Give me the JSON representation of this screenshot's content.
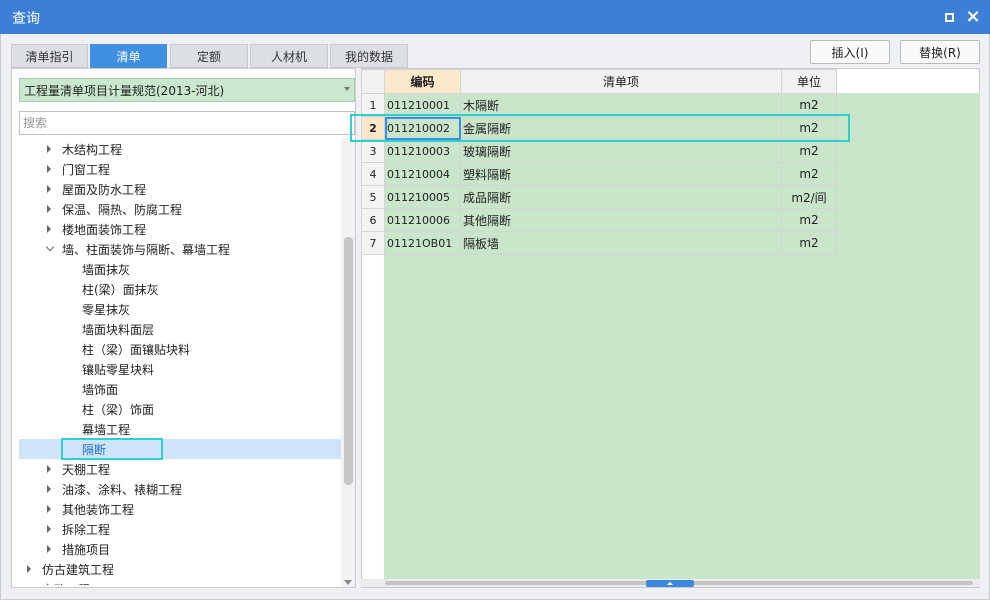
{
  "window": {
    "title": "查询"
  },
  "tabs": [
    {
      "label": "清单指引"
    },
    {
      "label": "清单"
    },
    {
      "label": "定额"
    },
    {
      "label": "人材机"
    },
    {
      "label": "我的数据"
    }
  ],
  "toolbar": {
    "insert_label": "插入(I)",
    "replace_label": "替换(R)"
  },
  "left": {
    "spec_select": "工程量清单项目计量规范(2013-河北)",
    "search_placeholder": "搜索",
    "tree": [
      {
        "label": "木结构工程",
        "expanded": false
      },
      {
        "label": "门窗工程",
        "expanded": false
      },
      {
        "label": "屋面及防水工程",
        "expanded": false
      },
      {
        "label": "保温、隔热、防腐工程",
        "expanded": false
      },
      {
        "label": "楼地面装饰工程",
        "expanded": false
      },
      {
        "label": "墙、柱面装饰与隔断、幕墙工程",
        "expanded": true
      },
      {
        "label": "墙面抹灰"
      },
      {
        "label": "柱(梁）面抹灰"
      },
      {
        "label": "零星抹灰"
      },
      {
        "label": "墙面块料面层"
      },
      {
        "label": "柱（梁）面镶贴块料"
      },
      {
        "label": "镶贴零星块料"
      },
      {
        "label": "墙饰面"
      },
      {
        "label": "柱（梁）饰面"
      },
      {
        "label": "幕墙工程"
      },
      {
        "label": "隔断",
        "selected": true
      },
      {
        "label": "天棚工程",
        "expanded": false
      },
      {
        "label": "油漆、涂料、裱糊工程",
        "expanded": false
      },
      {
        "label": "其他装饰工程",
        "expanded": false
      },
      {
        "label": "拆除工程",
        "expanded": false
      },
      {
        "label": "措施项目",
        "expanded": false
      },
      {
        "label": "仿古建筑工程",
        "expanded": false
      },
      {
        "label": "市政工程",
        "expanded": false
      }
    ]
  },
  "grid": {
    "headers": {
      "code": "编码",
      "item": "清单项",
      "unit": "单位"
    },
    "rows": [
      {
        "no": "1",
        "code": "011210001",
        "item": "木隔断",
        "unit": "m2"
      },
      {
        "no": "2",
        "code": "011210002",
        "item": "金属隔断",
        "unit": "m2"
      },
      {
        "no": "3",
        "code": "011210003",
        "item": "玻璃隔断",
        "unit": "m2"
      },
      {
        "no": "4",
        "code": "011210004",
        "item": "塑料隔断",
        "unit": "m2"
      },
      {
        "no": "5",
        "code": "011210005",
        "item": "成品隔断",
        "unit": "m2/间"
      },
      {
        "no": "6",
        "code": "011210006",
        "item": "其他隔断",
        "unit": "m2"
      },
      {
        "no": "7",
        "code": "01121OB01",
        "item": "隔板墙",
        "unit": "m2"
      }
    ]
  },
  "colors": {
    "titlebar": "#3d7fd6",
    "active_tab": "#3f8fe3",
    "highlight": "#2fcfd0",
    "green": "#c9e5ca"
  }
}
